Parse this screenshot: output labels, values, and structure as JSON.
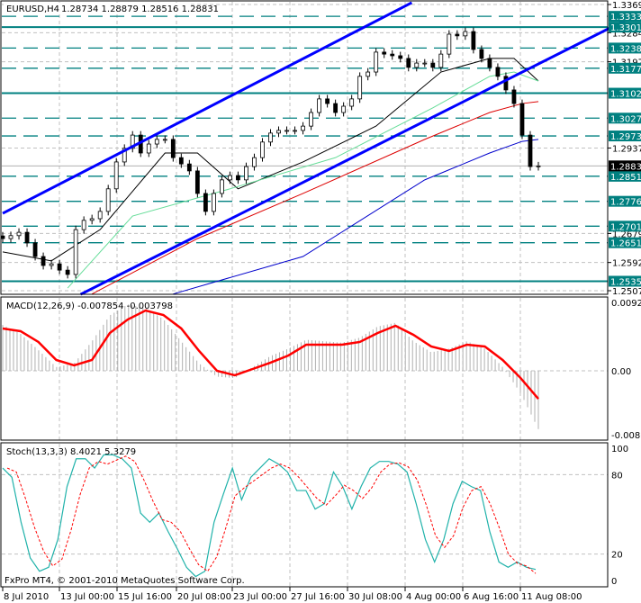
{
  "header": {
    "symbol_label": "EURUSD,H4",
    "ohlc": "1.28734 1.28879 1.28516 1.28831"
  },
  "footer": {
    "copyright": "FxPro MT4, © 2001-2010 MetaQuotes Software Corp."
  },
  "colors": {
    "level": "#008080",
    "trendline": "#0000ff",
    "macd_signal": "#ff0000",
    "macd_hist": "#b0b0b0",
    "stoch_main": "#20b2aa",
    "stoch_signal": "#ff0000",
    "ma_black": "#000000",
    "ma_green": "#66dd99",
    "ma_red": "#dd0000",
    "ma_blue": "#0000cc"
  },
  "chart_data": [
    {
      "type": "candlestick",
      "title": "EURUSD,H4",
      "ylim": [
        1.2507,
        1.33695
      ],
      "x_tick_labels": [
        "8 Jul 2010",
        "13 Jul 00:00",
        "15 Jul 16:00",
        "20 Jul 08:00",
        "23 Jul 00:00",
        "27 Jul 16:00",
        "30 Jul 08:00",
        "4 Aug 00:00",
        "6 Aug 16:00",
        "11 Aug 08:00"
      ],
      "y_tick_labels": [
        "1.33695",
        "1.32845",
        "1.31970",
        "1.29370",
        "1.26795",
        "1.25920",
        "1.25070"
      ],
      "closes": [
        1.2664,
        1.2673,
        1.2683,
        1.2651,
        1.261,
        1.2583,
        1.2588,
        1.2569,
        1.2556,
        1.2691,
        1.2719,
        1.2724,
        1.2746,
        1.2814,
        1.2895,
        1.2936,
        1.2976,
        1.2922,
        1.2949,
        1.2963,
        1.2963,
        1.2908,
        1.2889,
        1.2868,
        1.28,
        1.2746,
        1.28,
        1.2841,
        1.2854,
        1.2841,
        1.2881,
        1.2908,
        1.2955,
        1.2982,
        1.299,
        1.299,
        1.299,
        1.3003,
        1.3044,
        1.3085,
        1.3071,
        1.3044,
        1.3063,
        1.3085,
        1.3153,
        1.3166,
        1.3226,
        1.322,
        1.3215,
        1.3207,
        1.318,
        1.3193,
        1.3193,
        1.318,
        1.322,
        1.328,
        1.3275,
        1.3288,
        1.3234,
        1.3207,
        1.318,
        1.3153,
        1.3112,
        1.3071,
        1.2976,
        1.2881,
        1.28831
      ],
      "current_price": "1.28831",
      "levels": [
        {
          "price": "1.33338",
          "style": "dashed"
        },
        {
          "price": "1.33013",
          "style": "solid"
        },
        {
          "price": "1.32382",
          "style": "dashed"
        },
        {
          "price": "1.31775",
          "style": "dashed"
        },
        {
          "price": "1.31022",
          "style": "solid"
        },
        {
          "price": "1.30270",
          "style": "dashed"
        },
        {
          "price": "1.29734",
          "style": "dashed"
        },
        {
          "price": "1.28519",
          "style": "dashed"
        },
        {
          "price": "1.27764",
          "style": "dashed"
        },
        {
          "price": "1.27014",
          "style": "dashed"
        },
        {
          "price": "1.26516",
          "style": "dashed"
        },
        {
          "price": "1.25355",
          "style": "solid"
        }
      ],
      "trendlines": [
        {
          "from": [
            0,
            1.274
          ],
          "to": [
            50.4,
            1.3375
          ]
        },
        {
          "from": [
            9.6,
            1.2496
          ],
          "to": [
            81,
            1.3375
          ]
        }
      ],
      "moving_averages": [
        {
          "color": "#000000",
          "points": [
            [
              0,
              1.2624
            ],
            [
              6,
              1.2597
            ],
            [
              12,
              1.2691
            ],
            [
              20,
              1.2922
            ],
            [
              24,
              1.2922
            ],
            [
              29,
              1.2814
            ],
            [
              37,
              1.2895
            ],
            [
              46,
              1.3003
            ],
            [
              54,
              1.3166
            ],
            [
              60,
              1.3207
            ],
            [
              63,
              1.3207
            ],
            [
              66,
              1.3139
            ]
          ]
        },
        {
          "color": "#66dd99",
          "points": [
            [
              8,
              1.2515
            ],
            [
              16,
              1.2732
            ],
            [
              28,
              1.2814
            ],
            [
              41,
              1.2908
            ],
            [
              53,
              1.3058
            ],
            [
              60,
              1.3153
            ],
            [
              63,
              1.3166
            ],
            [
              66,
              1.3139
            ]
          ]
        },
        {
          "color": "#dd0000",
          "points": [
            [
              11,
              1.2497
            ],
            [
              24,
              1.2664
            ],
            [
              37,
              1.28
            ],
            [
              52,
              1.2963
            ],
            [
              60,
              1.3044
            ],
            [
              64,
              1.3071
            ],
            [
              66,
              1.3077
            ]
          ]
        },
        {
          "color": "#0000cc",
          "points": [
            [
              21,
              1.2497
            ],
            [
              37,
              1.261
            ],
            [
              52,
              1.2841
            ],
            [
              60,
              1.2922
            ],
            [
              64,
              1.2957
            ],
            [
              66,
              1.2963
            ]
          ]
        }
      ]
    },
    {
      "type": "bar+line",
      "title": "MACD(12,26,9) -0.007854 -0.003798",
      "ylim": [
        -0.00866,
        0.00926
      ],
      "y_tick_labels": [
        "0.00926",
        "0.00",
        "-0.00866"
      ],
      "main": [
        0.0062,
        0.005,
        0.0028,
        0.0005,
        0.001,
        0.004,
        0.0075,
        0.009,
        0.0085,
        0.007,
        0.004,
        0.001,
        -0.0008,
        -0.001,
        0.0005,
        0.002,
        0.003,
        0.0042,
        0.004,
        0.0038,
        0.0045,
        0.006,
        0.0065,
        0.004,
        0.0025,
        0.003,
        0.004,
        0.003,
        0.0005,
        -0.003,
        -0.0079
      ],
      "signal": [
        0.00573,
        0.00536,
        0.0039,
        0.00146,
        0.00073,
        0.00146,
        0.00512,
        0.00694,
        0.00816,
        0.00755,
        0.00573,
        0.00268,
        0,
        -0.00061,
        0.00024,
        0.0011,
        0.00207,
        0.00353,
        0.00353,
        0.00353,
        0.0039,
        0.00512,
        0.00609,
        0.00487,
        0.00329,
        0.00268,
        0.00353,
        0.00329,
        0.00146,
        -0.00097,
        -0.0038
      ]
    },
    {
      "type": "line",
      "title": "Stoch(13,3,3) 8.4021 5.3279",
      "ylim": [
        0,
        100
      ],
      "y_tick_labels": [
        "100",
        "80",
        "20",
        "0"
      ],
      "main": [
        85,
        78,
        44,
        17,
        7,
        10,
        31,
        71,
        92,
        92,
        85,
        95,
        95,
        92,
        85,
        51,
        44,
        51,
        37,
        24,
        10,
        3,
        7,
        44,
        65,
        85,
        61,
        78,
        85,
        92,
        88,
        82,
        68,
        68,
        54,
        58,
        82,
        71,
        54,
        71,
        85,
        90,
        90,
        88,
        82,
        58,
        31,
        14,
        31,
        58,
        75,
        71,
        68,
        37,
        14,
        10,
        14,
        10,
        8.4
      ],
      "signal": [
        85,
        82,
        62,
        40,
        22,
        11,
        16,
        38,
        65,
        85,
        90,
        88,
        91,
        94,
        90,
        76,
        60,
        46,
        44,
        37,
        24,
        12,
        7,
        18,
        40,
        64,
        70,
        75,
        80,
        85,
        88,
        85,
        78,
        70,
        62,
        57,
        64,
        72,
        68,
        62,
        70,
        82,
        88,
        89,
        86,
        76,
        57,
        34,
        25,
        34,
        55,
        68,
        71,
        58,
        40,
        20,
        13,
        11,
        5.3
      ]
    }
  ]
}
